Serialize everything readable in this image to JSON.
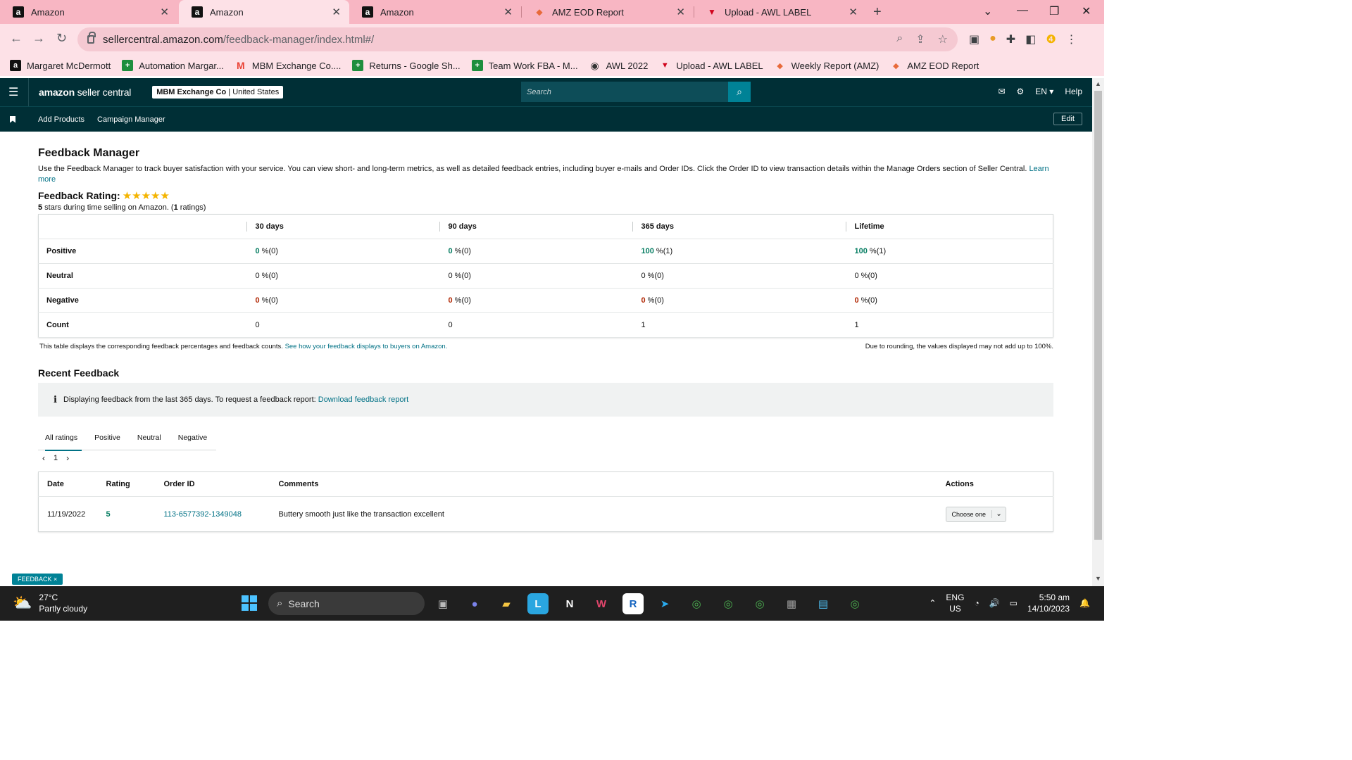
{
  "browser": {
    "tabs": [
      {
        "label": "Amazon",
        "favicon": "amazon-icon",
        "active": false
      },
      {
        "label": "Amazon",
        "favicon": "amazon-icon",
        "active": true
      },
      {
        "label": "Amazon",
        "favicon": "amazon-icon",
        "active": false
      },
      {
        "label": "AMZ EOD Report",
        "favicon": "report-icon",
        "active": false
      },
      {
        "label": "Upload - AWL LABEL",
        "favicon": "awl-icon",
        "active": false
      }
    ],
    "url_host": "sellercentral.amazon.com",
    "url_path": "/feedback-manager/index.html#/",
    "bookmarks": [
      {
        "label": "Margaret McDermott",
        "icon": "amazon-icon"
      },
      {
        "label": "Automation Margar...",
        "icon": "sheets-icon"
      },
      {
        "label": "MBM Exchange Co....",
        "icon": "gmail-icon"
      },
      {
        "label": "Returns - Google Sh...",
        "icon": "sheets-icon"
      },
      {
        "label": "Team Work FBA - M...",
        "icon": "sheets-icon"
      },
      {
        "label": "AWL 2022",
        "icon": "globe-icon"
      },
      {
        "label": "Upload - AWL LABEL",
        "icon": "awl-icon"
      },
      {
        "label": "Weekly Report (AMZ)",
        "icon": "report-icon"
      },
      {
        "label": "AMZ EOD Report",
        "icon": "report-icon"
      }
    ]
  },
  "header": {
    "logo_bold": "amazon",
    "logo_rest": " seller central",
    "merchant_name": "MBM Exchange Co",
    "merchant_region": " | United States",
    "search_placeholder": "Search",
    "lang": "EN ▾",
    "help": "Help",
    "subnav": [
      "Add Products",
      "Campaign Manager"
    ],
    "edit": "Edit"
  },
  "page": {
    "title": "Feedback Manager",
    "intro": "Use the Feedback Manager to track buyer satisfaction with your service. You can view short- and long-term metrics, as well as detailed feedback entries, including buyer e-mails and Order IDs. Click the Order ID to view transaction details within the Manage Orders section of Seller Central.",
    "learn_more": "Learn more",
    "rating_title": "Feedback Rating:",
    "rating_stars": 5,
    "rating_sub_stars": "5",
    "rating_sub_text": " stars during time selling on Amazon. (",
    "rating_sub_count": "1",
    "rating_sub_end": " ratings)",
    "metrics": {
      "columns": [
        "30 days",
        "90 days",
        "365 days",
        "Lifetime"
      ],
      "rows": [
        {
          "label": "Positive",
          "cells": [
            {
              "v": "0",
              "r": " %(0)"
            },
            {
              "v": "0",
              "r": " %(0)"
            },
            {
              "v": "100",
              "r": " %(1)"
            },
            {
              "v": "100",
              "r": " %(1)"
            }
          ]
        },
        {
          "label": "Neutral",
          "cells": [
            {
              "v": "0",
              "r": " %(0)"
            },
            {
              "v": "0",
              "r": " %(0)"
            },
            {
              "v": "0",
              "r": " %(0)"
            },
            {
              "v": "0",
              "r": " %(0)"
            }
          ]
        },
        {
          "label": "Negative",
          "cells": [
            {
              "v": "0",
              "r": " %(0)"
            },
            {
              "v": "0",
              "r": " %(0)"
            },
            {
              "v": "0",
              "r": " %(0)"
            },
            {
              "v": "0",
              "r": " %(0)"
            }
          ]
        },
        {
          "label": "Count",
          "cells": [
            {
              "v": "0",
              "r": ""
            },
            {
              "v": "0",
              "r": ""
            },
            {
              "v": "1",
              "r": ""
            },
            {
              "v": "1",
              "r": ""
            }
          ]
        }
      ]
    },
    "table_note": "This table displays the corresponding feedback percentages and feedback counts.",
    "table_note_link": "See how your feedback displays to buyers on Amazon.",
    "rounding_note": "Due to rounding, the values displayed may not add up to 100%.",
    "recent_title": "Recent Feedback",
    "info_text": "Displaying feedback from the last 365 days. To request a feedback report:",
    "info_link": "Download feedback report",
    "filter_tabs": [
      "All ratings",
      "Positive",
      "Neutral",
      "Negative"
    ],
    "page_number": "1",
    "feedback_columns": [
      "Date",
      "Rating",
      "Order ID",
      "Comments",
      "Actions"
    ],
    "feedback_rows": [
      {
        "date": "11/19/2022",
        "rating": "5",
        "order_id": "113-6577392-1349048",
        "comment": "Buttery smooth just like the transaction excellent",
        "action": "Choose one"
      }
    ],
    "feedback_pill": "FEEDBACK ×"
  },
  "taskbar": {
    "temp": "27°C",
    "weather": "Partly cloudy",
    "search": "Search",
    "lang1": "ENG",
    "lang2": "US",
    "time": "5:50 am",
    "date": "14/10/2023"
  },
  "colors": {
    "header_bg": "#002f36",
    "link": "#007185",
    "positive": "#067d62",
    "negative": "#b12704",
    "star": "#f4b400"
  }
}
